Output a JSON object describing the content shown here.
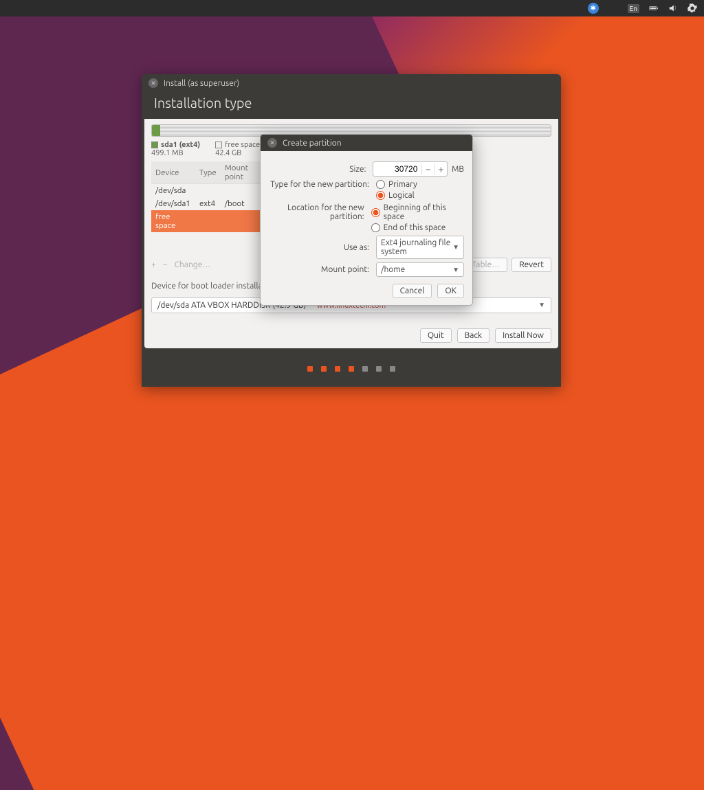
{
  "panel": {
    "input_method": "En"
  },
  "window": {
    "title": "Install (as superuser)",
    "heading": "Installation type"
  },
  "legend": {
    "part1": {
      "name": "sda1 (ext4)",
      "size": "499.1 MB"
    },
    "free": {
      "name": "free space",
      "size": "42.4 GB"
    }
  },
  "table": {
    "cols": [
      "Device",
      "Type",
      "Mount point"
    ],
    "rows": [
      {
        "device": "/dev/sda",
        "type": "",
        "mount": ""
      },
      {
        "device": "/dev/sda1",
        "type": "ext4",
        "mount": "/boot"
      },
      {
        "device": "free space",
        "type": "",
        "mount": ""
      }
    ]
  },
  "tools": {
    "plus": "+",
    "minus": "−",
    "change": "Change…",
    "new_table": "New Partition Table…",
    "revert": "Revert"
  },
  "bootloader": {
    "label": "Device for boot loader installation:",
    "value": "/dev/sda   ATA VBOX HARDDISK (42.9 GB)"
  },
  "buttons": {
    "quit": "Quit",
    "back": "Back",
    "install": "Install Now"
  },
  "watermark": "www.linuxtechi.com",
  "dialog": {
    "title": "Create partition",
    "size_label": "Size:",
    "size_value": "30720",
    "size_unit": "MB",
    "type_label": "Type for the new partition:",
    "type_primary": "Primary",
    "type_logical": "Logical",
    "loc_label": "Location for the new partition:",
    "loc_begin": "Beginning of this space",
    "loc_end": "End of this space",
    "useas_label": "Use as:",
    "useas_value": "Ext4 journaling file system",
    "mount_label": "Mount point:",
    "mount_value": "/home",
    "cancel": "Cancel",
    "ok": "OK"
  }
}
